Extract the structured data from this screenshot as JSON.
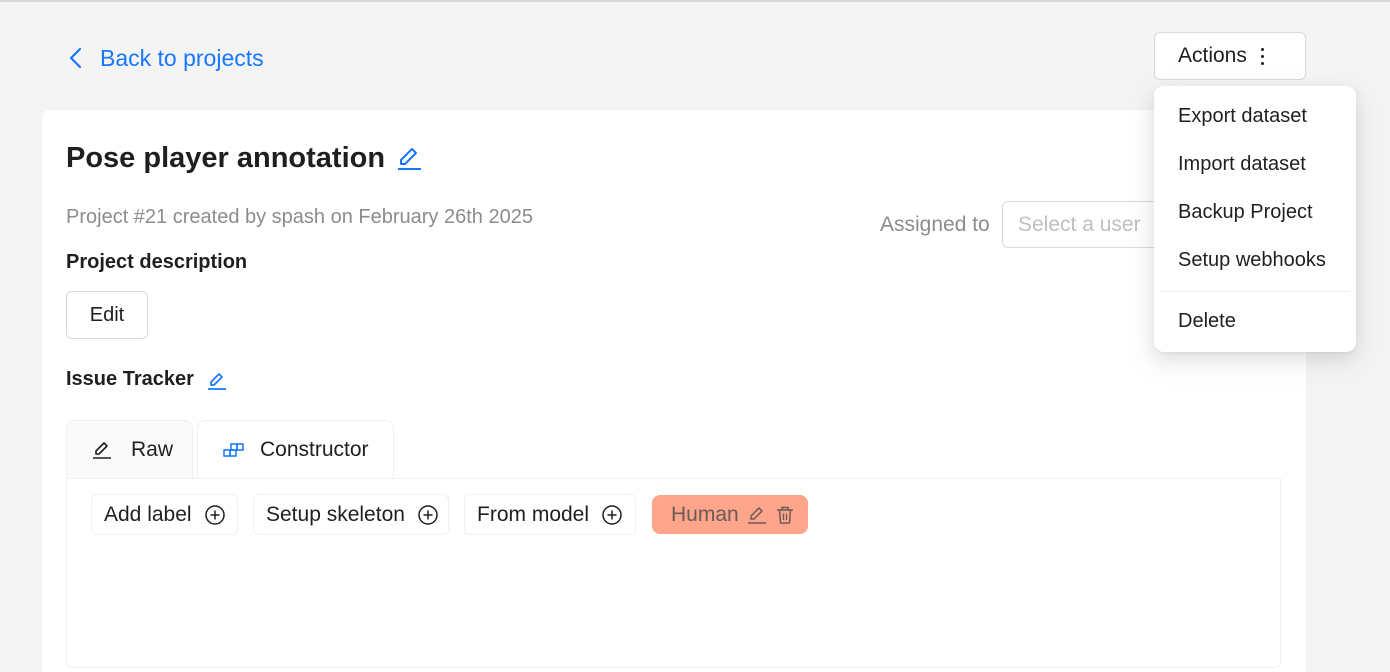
{
  "nav": {
    "back_label": "Back to projects"
  },
  "actions": {
    "label": "Actions",
    "menu": [
      "Export dataset",
      "Import dataset",
      "Backup Project",
      "Setup webhooks",
      "Delete"
    ]
  },
  "project": {
    "title": "Pose player annotation",
    "meta": "Project #21 created by spash on February 26th 2025",
    "assigned_label": "Assigned to",
    "assignee_placeholder": "Select a user",
    "description_label": "Project description",
    "edit_label": "Edit",
    "issue_tracker_label": "Issue Tracker"
  },
  "tabs": [
    {
      "label": "Raw",
      "icon": "pencil-icon"
    },
    {
      "label": "Constructor",
      "icon": "blocks-icon",
      "active": true
    }
  ],
  "constructor": {
    "buttons": [
      "Add label",
      "Setup skeleton",
      "From model"
    ],
    "labels": [
      {
        "name": "Human",
        "color": "#fea58c"
      }
    ]
  },
  "colors": {
    "accent": "#1677ff",
    "label_human": "#fea58c"
  }
}
